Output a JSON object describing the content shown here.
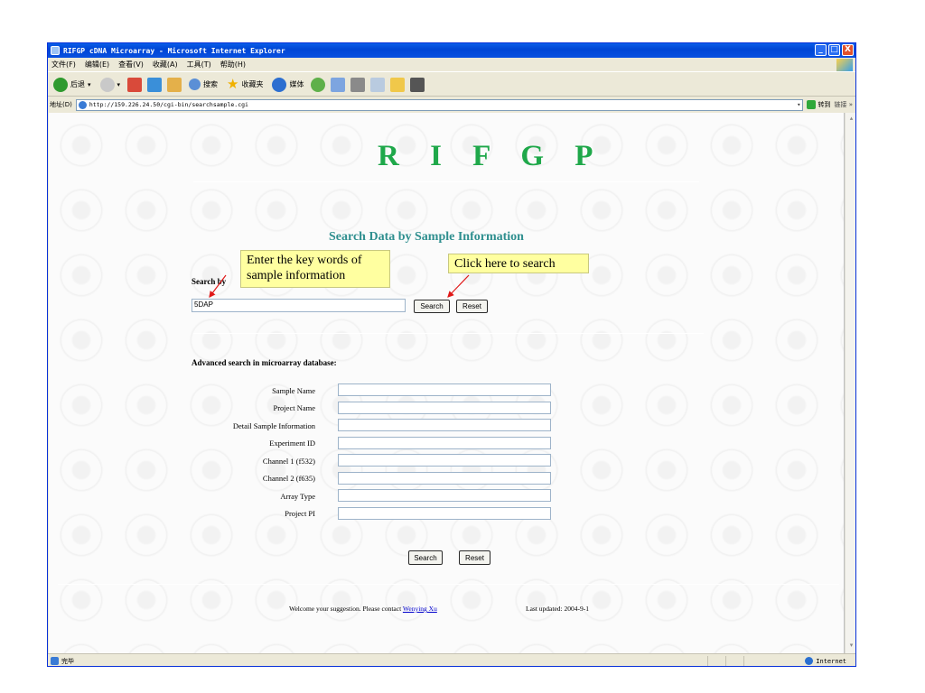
{
  "window": {
    "title": "RIFGP cDNA Microarray - Microsoft Internet Explorer",
    "controls": [
      "_",
      "□",
      "X"
    ]
  },
  "menu": [
    "文件(F)",
    "编辑(E)",
    "查看(V)",
    "收藏(A)",
    "工具(T)",
    "帮助(H)"
  ],
  "toolbar": {
    "back_label": "后退",
    "search_label": "搜索",
    "favorites_label": "收藏夹",
    "media_label": "媒体"
  },
  "address": {
    "label": "地址(D)",
    "url": "http://159.226.24.50/cgi-bin/searchsample.cgi",
    "go_label": "转到",
    "links_label": "链接 »"
  },
  "page": {
    "logo": "R I F G P",
    "subtitle": "Search Data by Sample Information",
    "quick_search": {
      "label": "Search by",
      "value": "5DAP",
      "search_button": "Search",
      "reset_button": "Reset"
    },
    "advanced": {
      "heading": "Advanced search in microarray database:",
      "fields": [
        {
          "label": "Sample Name",
          "value": ""
        },
        {
          "label": "Project Name",
          "value": ""
        },
        {
          "label": "Detail Sample Information",
          "value": ""
        },
        {
          "label": "Experiment ID",
          "value": ""
        },
        {
          "label": "Channel 1 (f532)",
          "value": ""
        },
        {
          "label": "Channel 2 (f635)",
          "value": ""
        },
        {
          "label": "Array Type",
          "value": ""
        },
        {
          "label": "Project PI",
          "value": ""
        }
      ],
      "search_button": "Search",
      "reset_button": "Reset"
    },
    "footer": {
      "text": "Welcome your suggestion. Please contact",
      "contact_link": "Wenying Xu",
      "last_updated": "Last updated: 2004-9-1"
    }
  },
  "annotations": {
    "callout_input": "Enter the key words of sample information",
    "callout_search": "Click here to search"
  },
  "status": {
    "text": "完毕",
    "zone": "Internet"
  }
}
